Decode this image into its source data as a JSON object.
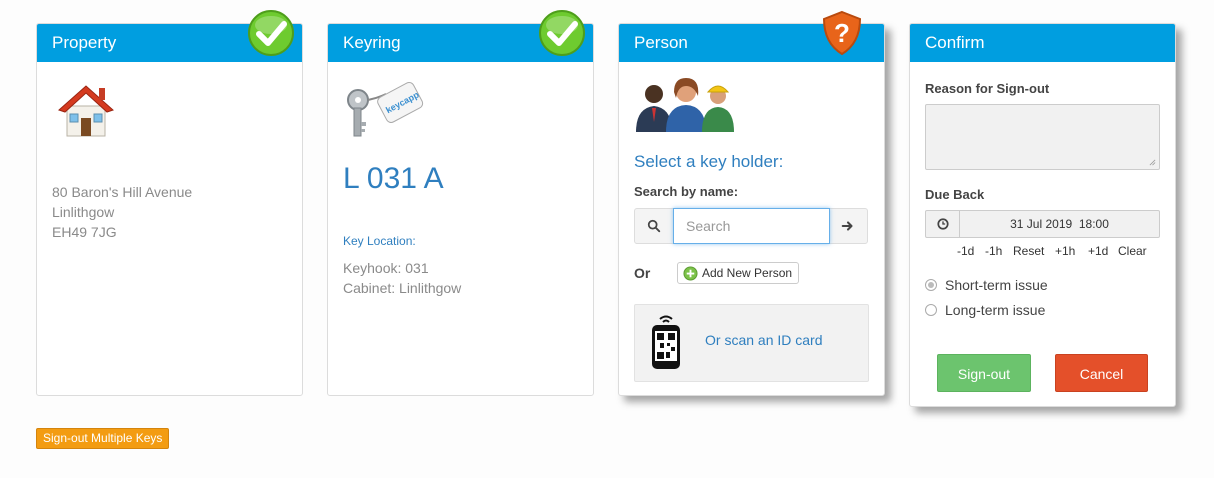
{
  "property": {
    "title": "Property",
    "address_line1": "80 Baron's Hill Avenue",
    "address_line2": "Linlithgow",
    "address_line3": "EH49 7JG"
  },
  "keyring": {
    "title": "Keyring",
    "tag_brand": "keycapp",
    "code": "L 031 A",
    "location_label": "Key Location:",
    "keyhook": "Keyhook: 031",
    "cabinet": "Cabinet: Linlithgow"
  },
  "person": {
    "title": "Person",
    "select_heading": "Select a key holder:",
    "search_label": "Search by name:",
    "search_placeholder": "Search",
    "or_label": "Or",
    "add_new_label": "Add New Person",
    "scan_label": "Or scan an ID card"
  },
  "confirm": {
    "title": "Confirm",
    "reason_label": "Reason for Sign-out",
    "due_back_label": "Due Back",
    "due_back_value": "31 Jul 2019  18:00",
    "quick_buttons": [
      "-1d",
      "-1h",
      "Reset",
      "+1h",
      "+1d",
      "Clear"
    ],
    "options": [
      {
        "label": "Short-term issue",
        "checked": true
      },
      {
        "label": "Long-term issue",
        "checked": false
      }
    ],
    "signout_label": "Sign-out",
    "cancel_label": "Cancel"
  },
  "footer": {
    "multi_keys_label": "Sign-out Multiple Keys"
  },
  "colors": {
    "header_blue": "#009ee0",
    "check_green": "#6ecb2f",
    "warning_orange": "#e8641a",
    "signout_green": "#6cc46e",
    "cancel_red": "#e4502a",
    "multi_orange": "#f39c12"
  },
  "icons": {
    "property_badge": "check-icon",
    "keyring_badge": "check-icon",
    "person_badge": "question-shield-icon",
    "house": "house-icon",
    "keys": "keys-icon",
    "people": "people-icon",
    "search": "search-icon",
    "go": "arrow-right-icon",
    "add": "plus-circle-icon",
    "phone": "phone-qr-icon",
    "clock": "clock-icon"
  }
}
